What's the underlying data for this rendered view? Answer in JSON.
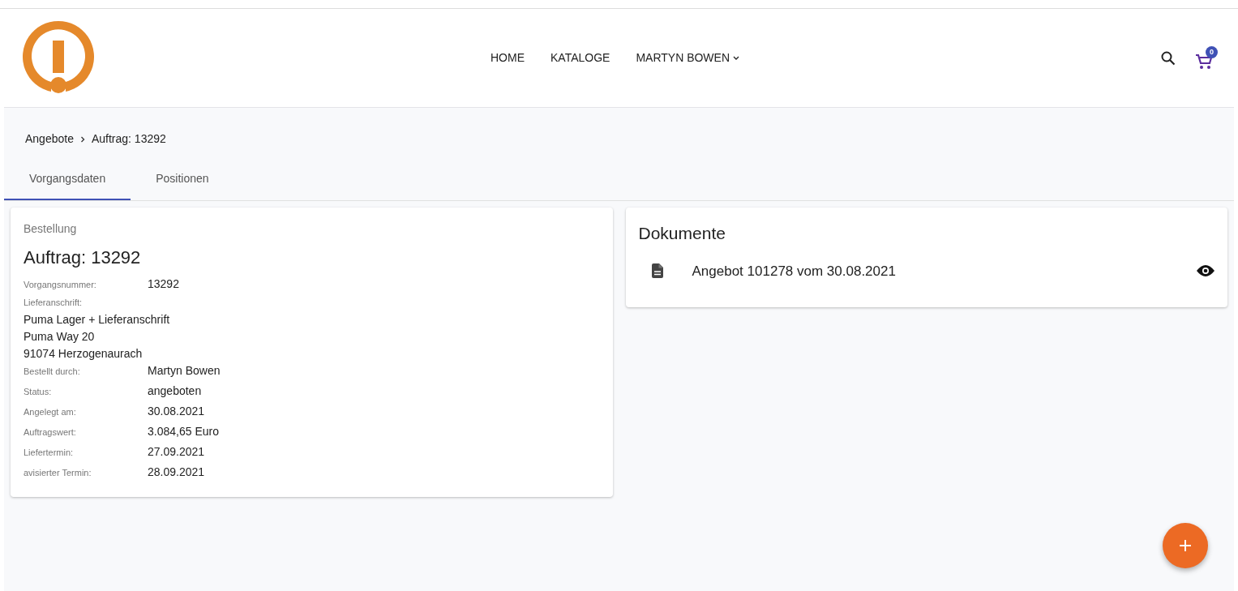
{
  "nav": {
    "items": [
      {
        "label": "HOME",
        "kind": "link"
      },
      {
        "label": "KATALOGE",
        "kind": "link"
      },
      {
        "label": "MARTYN BOWEN",
        "kind": "dropdown"
      }
    ],
    "cart_count": "0"
  },
  "breadcrumb": [
    "Angebote",
    "Auftrag: 13292"
  ],
  "tabs": [
    {
      "label": "Vorgangsdaten",
      "selected": true
    },
    {
      "label": "Positionen",
      "selected": false
    }
  ],
  "order": {
    "subtitle": "Bestellung",
    "title": "Auftrag: 13292",
    "fields": [
      {
        "kind": "pair",
        "label": "Vorgangsnummer:",
        "value": "13292"
      },
      {
        "kind": "address",
        "label": "Lieferanschrift:",
        "lines": [
          "Puma Lager + Lieferanschrift",
          "Puma Way 20",
          "91074 Herzogenaurach"
        ]
      },
      {
        "kind": "pair",
        "label": "Bestellt durch:",
        "value": "Martyn Bowen"
      },
      {
        "kind": "pair",
        "label": "Status:",
        "value": "angeboten"
      },
      {
        "kind": "pair",
        "label": "Angelegt am:",
        "value": "30.08.2021"
      },
      {
        "kind": "pair",
        "label": "Auftragswert:",
        "value": "3.084,65 Euro"
      },
      {
        "kind": "pair",
        "label": "Liefertermin:",
        "value": "27.09.2021"
      },
      {
        "kind": "pair",
        "label": "avisierter Termin:",
        "value": "28.09.2021"
      }
    ]
  },
  "documents": {
    "title": "Dokumente",
    "items": [
      {
        "label": "Angebot 101278 vom 30.08.2021"
      }
    ]
  }
}
